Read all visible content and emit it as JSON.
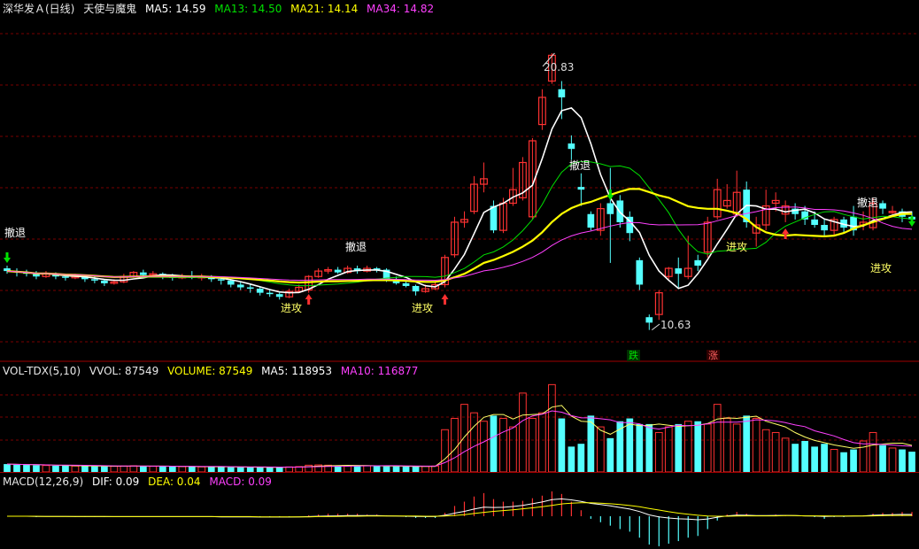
{
  "header_main": {
    "title": "深华发Ａ(日线)",
    "indicator": "天使与魔鬼",
    "ma5": "MA5: 14.59",
    "ma13": "MA13: 14.50",
    "ma21": "MA21: 14.14",
    "ma34": "MA34: 14.82"
  },
  "header_vol": {
    "name": "VOL-TDX(5,10)",
    "vvol": "VVOL: 87549",
    "volume": "VOLUME: 87549",
    "ma5": "MA5: 118953",
    "ma10": "MA10: 116877"
  },
  "header_macd": {
    "name": "MACD(12,26,9)",
    "dif": "DIF: 0.09",
    "dea": "DEA: 0.04",
    "macd": "MACD: 0.09"
  },
  "annotations": {
    "chetui": "撤退",
    "jingong": "进攻",
    "high_label": "20.83",
    "low_label": "10.63",
    "die": "跌",
    "zhang": "涨"
  },
  "colors": {
    "up": "#ff3232",
    "down": "#54ffff",
    "ma5": "#ffffff",
    "ma13": "#00e000",
    "ma21": "#ffff00",
    "ma34": "#ff40ff",
    "grid": "#7a0000"
  },
  "chart_data": [
    {
      "type": "candlestick",
      "title": "深华发Ａ(日线)",
      "ylim": [
        9.9,
        22.2
      ],
      "high": 20.83,
      "low": 10.63,
      "series": [
        {
          "name": "MA5",
          "values": [
            14.59
          ]
        },
        {
          "name": "MA13",
          "values": [
            14.5
          ]
        },
        {
          "name": "MA21",
          "values": [
            14.14
          ]
        },
        {
          "name": "MA34",
          "values": [
            14.82
          ]
        }
      ],
      "candles": [
        [
          12.9,
          12.8,
          13.0,
          12.7
        ],
        [
          12.8,
          12.75,
          12.9,
          12.6
        ],
        [
          12.75,
          12.7,
          12.85,
          12.6
        ],
        [
          12.7,
          12.6,
          12.8,
          12.5
        ],
        [
          12.6,
          12.7,
          12.8,
          12.55
        ],
        [
          12.7,
          12.6,
          12.75,
          12.5
        ],
        [
          12.6,
          12.55,
          12.7,
          12.45
        ],
        [
          12.55,
          12.6,
          12.7,
          12.5
        ],
        [
          12.6,
          12.5,
          12.65,
          12.4
        ],
        [
          12.5,
          12.45,
          12.6,
          12.35
        ],
        [
          12.45,
          12.35,
          12.5,
          12.25
        ],
        [
          12.35,
          12.4,
          12.5,
          12.3
        ],
        [
          12.4,
          12.6,
          12.7,
          12.35
        ],
        [
          12.6,
          12.75,
          12.8,
          12.55
        ],
        [
          12.75,
          12.65,
          12.85,
          12.6
        ],
        [
          12.65,
          12.7,
          12.8,
          12.6
        ],
        [
          12.7,
          12.6,
          12.75,
          12.5
        ],
        [
          12.6,
          12.55,
          12.7,
          12.45
        ],
        [
          12.55,
          12.6,
          12.7,
          12.5
        ],
        [
          12.6,
          12.55,
          12.8,
          12.5
        ],
        [
          12.55,
          12.6,
          12.7,
          12.45
        ],
        [
          12.6,
          12.5,
          12.65,
          12.4
        ],
        [
          12.5,
          12.45,
          12.6,
          12.3
        ],
        [
          12.45,
          12.3,
          12.5,
          12.2
        ],
        [
          12.3,
          12.2,
          12.4,
          12.1
        ],
        [
          12.2,
          12.15,
          12.3,
          12.0
        ],
        [
          12.15,
          12.0,
          12.2,
          11.9
        ],
        [
          12.0,
          11.95,
          12.1,
          11.85
        ],
        [
          11.95,
          11.85,
          12.0,
          11.75
        ],
        [
          11.85,
          12.05,
          12.15,
          11.8
        ],
        [
          12.05,
          12.2,
          12.3,
          12.0
        ],
        [
          12.1,
          12.6,
          12.65,
          12.0
        ],
        [
          12.6,
          12.8,
          12.9,
          12.55
        ],
        [
          12.8,
          12.85,
          12.95,
          12.7
        ],
        [
          12.85,
          12.75,
          12.95,
          12.7
        ],
        [
          12.75,
          12.9,
          13.0,
          12.7
        ],
        [
          12.9,
          12.8,
          13.0,
          12.7
        ],
        [
          12.8,
          12.9,
          13.0,
          12.75
        ],
        [
          12.9,
          12.85,
          12.95,
          12.75
        ],
        [
          12.85,
          12.5,
          12.9,
          12.4
        ],
        [
          12.5,
          12.35,
          12.6,
          12.3
        ],
        [
          12.35,
          12.25,
          12.45,
          12.2
        ],
        [
          12.25,
          12.05,
          12.3,
          11.9
        ],
        [
          12.05,
          12.15,
          12.3,
          12.0
        ],
        [
          12.15,
          12.3,
          12.4,
          12.1
        ],
        [
          12.3,
          13.3,
          13.4,
          12.2
        ],
        [
          13.4,
          14.6,
          14.8,
          13.3
        ],
        [
          14.6,
          14.7,
          15.0,
          14.4
        ],
        [
          15.0,
          16.0,
          16.3,
          14.9
        ],
        [
          16.0,
          16.2,
          16.8,
          15.7
        ],
        [
          15.2,
          14.3,
          15.4,
          14.2
        ],
        [
          14.3,
          15.3,
          15.5,
          14.2
        ],
        [
          15.3,
          15.8,
          16.6,
          15.2
        ],
        [
          15.5,
          16.8,
          17.0,
          15.4
        ],
        [
          14.8,
          17.6,
          17.7,
          14.7
        ],
        [
          18.2,
          19.2,
          19.5,
          18.0
        ],
        [
          19.8,
          20.75,
          20.83,
          19.7
        ],
        [
          19.5,
          19.2,
          19.8,
          18.4
        ],
        [
          17.5,
          17.3,
          17.8,
          16.9
        ],
        [
          15.9,
          15.8,
          16.4,
          15.2
        ],
        [
          14.9,
          14.4,
          15.0,
          14.3
        ],
        [
          14.3,
          15.1,
          15.3,
          14.1
        ],
        [
          15.3,
          14.9,
          16.6,
          13.1
        ],
        [
          15.4,
          14.6,
          15.6,
          14.4
        ],
        [
          14.8,
          14.2,
          15.0,
          13.9
        ],
        [
          13.2,
          12.3,
          13.3,
          12.1
        ],
        [
          11.1,
          10.9,
          11.2,
          10.63
        ],
        [
          11.2,
          12.0,
          12.1,
          11.0
        ],
        [
          12.6,
          12.9,
          12.95,
          12.5
        ],
        [
          12.9,
          12.7,
          13.3,
          12.2
        ],
        [
          12.6,
          12.9,
          14.1,
          12.5
        ],
        [
          13.2,
          13.0,
          13.4,
          12.8
        ],
        [
          13.5,
          14.6,
          14.8,
          13.3
        ],
        [
          14.8,
          15.8,
          16.2,
          14.7
        ],
        [
          15.2,
          15.4,
          16.0,
          15.1
        ],
        [
          14.9,
          15.7,
          16.5,
          14.8
        ],
        [
          15.8,
          14.6,
          16.1,
          14.4
        ],
        [
          14.2,
          14.5,
          14.8,
          13.7
        ],
        [
          14.5,
          15.2,
          15.8,
          14.3
        ],
        [
          15.3,
          15.4,
          15.7,
          15.0
        ],
        [
          14.9,
          15.2,
          15.4,
          14.6
        ],
        [
          15.1,
          14.9,
          15.3,
          14.7
        ],
        [
          15.0,
          14.7,
          15.2,
          14.5
        ],
        [
          14.7,
          14.5,
          15.0,
          14.4
        ],
        [
          14.5,
          14.3,
          14.7,
          14.1
        ],
        [
          14.3,
          14.7,
          14.8,
          14.1
        ],
        [
          14.7,
          14.4,
          14.8,
          14.2
        ],
        [
          14.8,
          14.3,
          15.2,
          14.1
        ],
        [
          14.5,
          14.6,
          15.0,
          14.3
        ],
        [
          14.4,
          15.3,
          15.5,
          14.3
        ],
        [
          15.3,
          15.1,
          15.4,
          14.9
        ],
        [
          15.0,
          15.0,
          15.2,
          14.9
        ],
        [
          15.0,
          14.8,
          15.1,
          14.6
        ],
        [
          14.8,
          14.7,
          15.0,
          14.5
        ]
      ]
    },
    {
      "type": "bar",
      "title": "VOL-TDX(5,10)",
      "ylim": [
        0,
        330000
      ],
      "series": [
        {
          "name": "VVOL",
          "values": [
            87549
          ]
        },
        {
          "name": "VOLUME",
          "values": [
            87549
          ]
        },
        {
          "name": "MA5",
          "values": [
            118953
          ]
        },
        {
          "name": "MA10",
          "values": [
            116877
          ]
        }
      ],
      "volumes": [
        28000,
        26000,
        25000,
        24000,
        23000,
        22000,
        22000,
        21000,
        21000,
        20000,
        20000,
        20000,
        21000,
        22000,
        21000,
        20000,
        20000,
        19000,
        19000,
        19000,
        18000,
        18000,
        18000,
        17000,
        17000,
        17000,
        16000,
        17000,
        17000,
        18000,
        19000,
        24000,
        25000,
        24000,
        23000,
        22000,
        22000,
        22000,
        21000,
        20000,
        20000,
        19000,
        19000,
        20000,
        21000,
        150000,
        190000,
        240000,
        210000,
        180000,
        200000,
        190000,
        160000,
        280000,
        190000,
        210000,
        310000,
        190000,
        90000,
        100000,
        200000,
        160000,
        120000,
        180000,
        190000,
        170000,
        170000,
        140000,
        160000,
        170000,
        180000,
        180000,
        170000,
        240000,
        190000,
        170000,
        200000,
        190000,
        150000,
        140000,
        120000,
        100000,
        110000,
        90000,
        100000,
        80000,
        70000,
        80000,
        110000,
        140000,
        95000,
        85000,
        80000,
        72000
      ]
    },
    {
      "type": "bar",
      "title": "MACD(12,26,9)",
      "ylim": [
        -0.9,
        1.1
      ],
      "series": [
        {
          "name": "DIF",
          "values": [
            0.09
          ]
        },
        {
          "name": "DEA",
          "values": [
            0.04
          ]
        },
        {
          "name": "MACD",
          "values": [
            0.09
          ]
        }
      ],
      "dif": [
        0,
        0,
        0,
        -0.01,
        -0.01,
        -0.01,
        -0.01,
        -0.02,
        -0.02,
        -0.02,
        -0.02,
        -0.02,
        -0.02,
        -0.02,
        -0.02,
        -0.02,
        -0.02,
        -0.02,
        -0.02,
        -0.02,
        -0.02,
        -0.02,
        -0.03,
        -0.03,
        -0.03,
        -0.03,
        -0.04,
        -0.04,
        -0.04,
        -0.04,
        -0.03,
        -0.02,
        0,
        0.01,
        0.02,
        0.03,
        0.03,
        0.03,
        0.03,
        0.02,
        0.01,
        0,
        -0.01,
        -0.02,
        -0.02,
        0.05,
        0.16,
        0.25,
        0.37,
        0.47,
        0.45,
        0.46,
        0.5,
        0.56,
        0.64,
        0.73,
        0.85,
        0.89,
        0.84,
        0.76,
        0.66,
        0.6,
        0.53,
        0.45,
        0.37,
        0.24,
        0.07,
        -0.03,
        -0.09,
        -0.13,
        -0.15,
        -0.18,
        -0.14,
        -0.05,
        0.02,
        0.06,
        0.05,
        0.03,
        0.03,
        0.04,
        0.04,
        0.03,
        0.02,
        0.01,
        -0.01,
        0,
        0,
        0.01,
        0.02,
        0.05,
        0.07,
        0.08,
        0.09,
        0.09
      ],
      "dea": [
        0,
        0,
        0,
        0,
        -0.01,
        -0.01,
        -0.01,
        -0.01,
        -0.01,
        -0.01,
        -0.01,
        -0.02,
        -0.02,
        -0.02,
        -0.02,
        -0.02,
        -0.02,
        -0.02,
        -0.02,
        -0.02,
        -0.02,
        -0.02,
        -0.02,
        -0.02,
        -0.02,
        -0.02,
        -0.03,
        -0.03,
        -0.03,
        -0.03,
        -0.03,
        -0.03,
        -0.02,
        -0.02,
        -0.01,
        0,
        0,
        0.01,
        0.01,
        0.01,
        0.01,
        0.01,
        0.01,
        0,
        0,
        0.01,
        0.04,
        0.08,
        0.14,
        0.2,
        0.25,
        0.29,
        0.33,
        0.38,
        0.43,
        0.49,
        0.56,
        0.63,
        0.67,
        0.69,
        0.69,
        0.67,
        0.64,
        0.6,
        0.55,
        0.49,
        0.4,
        0.32,
        0.23,
        0.16,
        0.1,
        0.05,
        0.01,
        0,
        0,
        0.01,
        0.02,
        0.02,
        0.02,
        0.02,
        0.03,
        0.03,
        0.02,
        0.02,
        0.02,
        0.01,
        0.01,
        0.01,
        0.01,
        0.02,
        0.03,
        0.04,
        0.04,
        0.04
      ]
    }
  ]
}
